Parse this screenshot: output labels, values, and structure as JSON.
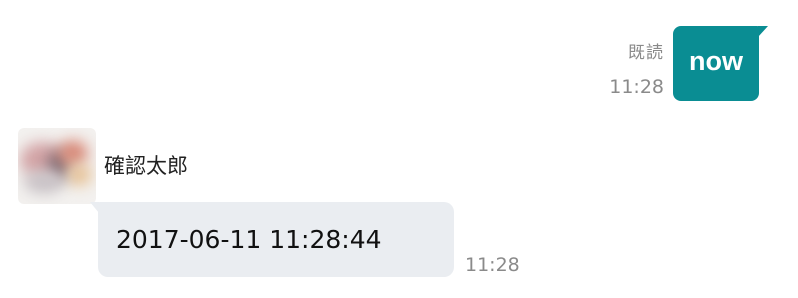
{
  "outgoing": {
    "read_status": "既読",
    "time": "11:28",
    "text": "now",
    "bubble_color": "#0a8d93"
  },
  "incoming": {
    "sender_name": "確認太郎",
    "text": "2017-06-11 11:28:44",
    "time": "11:28",
    "bubble_color": "#eaedf1"
  }
}
